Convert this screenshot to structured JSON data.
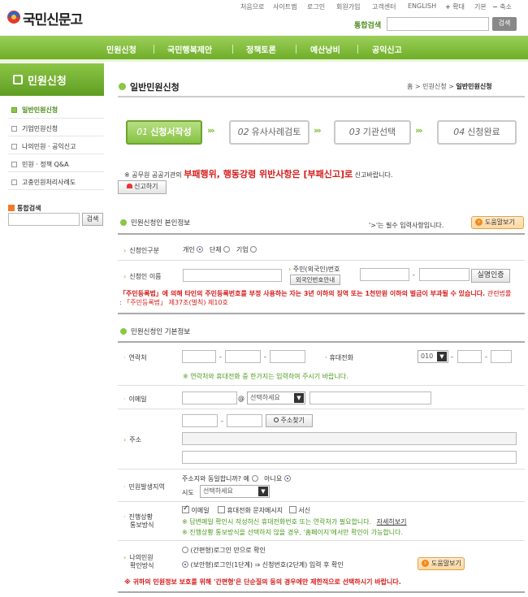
{
  "logo": {
    "text": "국민신문고"
  },
  "topnav": [
    "처음으로",
    "사이트맵",
    "로그인",
    "회원가입",
    "고객센터",
    "ENGLISH",
    "확대",
    "기본",
    "축소"
  ],
  "search": {
    "label": "통합검색",
    "button": "검색",
    "value": ""
  },
  "gnb": [
    "민원신청",
    "국민행복제안",
    "정책토론",
    "예산낭비",
    "공익신고"
  ],
  "sidebar": {
    "title": "민원신청",
    "items": [
      "일반민원신청",
      "기업민원신청",
      "나의민원 · 공익신고",
      "민원 · 정책 Q&A",
      "고충민원처리사례도"
    ],
    "search_label": "통합검색",
    "search_button": "검색"
  },
  "page": {
    "title": "일반민원신청",
    "breadcrumb": [
      "홈",
      ">",
      "민원신청",
      ">",
      "일반민원신청"
    ]
  },
  "steps": [
    {
      "num": "01",
      "label": "신청서작성"
    },
    {
      "num": "02",
      "label": "유사사례검토"
    },
    {
      "num": "03",
      "label": "기관선택"
    },
    {
      "num": "04",
      "label": "신청완료"
    }
  ],
  "notice": {
    "prefix": "※ 공무원 공공기관의",
    "red": "부패행위, 행동강령 위반사항은 [부패신고]로",
    "suffix": "신고바랍니다.",
    "button": "신고하기"
  },
  "identity": {
    "heading": "민원신청인 본인정보",
    "required_note": "'>'는 필수 입력사항입니다.",
    "help": "도움말보기",
    "type_label": "신청인구분",
    "type_options": [
      "개인",
      "단체",
      "기업"
    ],
    "name_label": "신청인 이름",
    "rrn_label": "주민(외국인)번호",
    "foreign_button": "외국인번호안내",
    "verify_button": "실명인증",
    "warning": "「주민등록법」에 의해 타인의 주민등록번호를 부정 사용하는 자는 3년 이하의 징역 또는 1천만원 이하의 벌금이 부과될 수 있습니다.",
    "warning_ref": "관련법률 : 「주민등록법」 제37조(벌칙) 제10호"
  },
  "basic": {
    "heading": "민원신청인 기본정보",
    "contact_label": "연락처",
    "mobile_label": "휴대전화",
    "mobile_prefix": "010",
    "contact_note": "※ 연락처와 휴대전화 중 한가지는 입력하여 주시기 바랍니다.",
    "email_label": "이메일",
    "email_at": "@",
    "email_select": "선택하세요",
    "address_label": "주소",
    "zip_button": "주소찾기",
    "origin_label": "민원발생지역",
    "origin_question": "주소지와 동일합니까?",
    "origin_yes": "예",
    "origin_no": "아니요",
    "sido_label": "시도",
    "sido_select": "선택하세요",
    "notify_label1": "진행상황",
    "notify_label2": "통보방식",
    "notify_options": [
      "이메일",
      "휴대전화 문자메시지",
      "서신"
    ],
    "notify_note1": "※ 답변메일 확인시 작성하신 휴대전화번호 또는 연락처가 필요합니다.",
    "notify_detail": "자세히보기",
    "notify_note2": "※ 진행상황 통보방식을 선택하지 않을 경우, '홈페이지'에서만 확인이 가능합니다.",
    "check_label1": "나의민원",
    "check_label2": "확인방식",
    "check_opt1": "(간편형)로그인 만으로 확인",
    "check_opt2": "(보안형)로그인(1단계) ⇒ 신청번호(2단계) 입력 후 확인",
    "help": "도움말보기",
    "bottom_note": "※ 귀하의 민원정보 보호를 위해 '간편형'은 단순질의 등의 경우에만 제한적으로 선택하시기 바랍니다."
  },
  "colors": {
    "accent": "#7cb33a",
    "warning": "#d51c1c",
    "brand": "#6fae28"
  }
}
